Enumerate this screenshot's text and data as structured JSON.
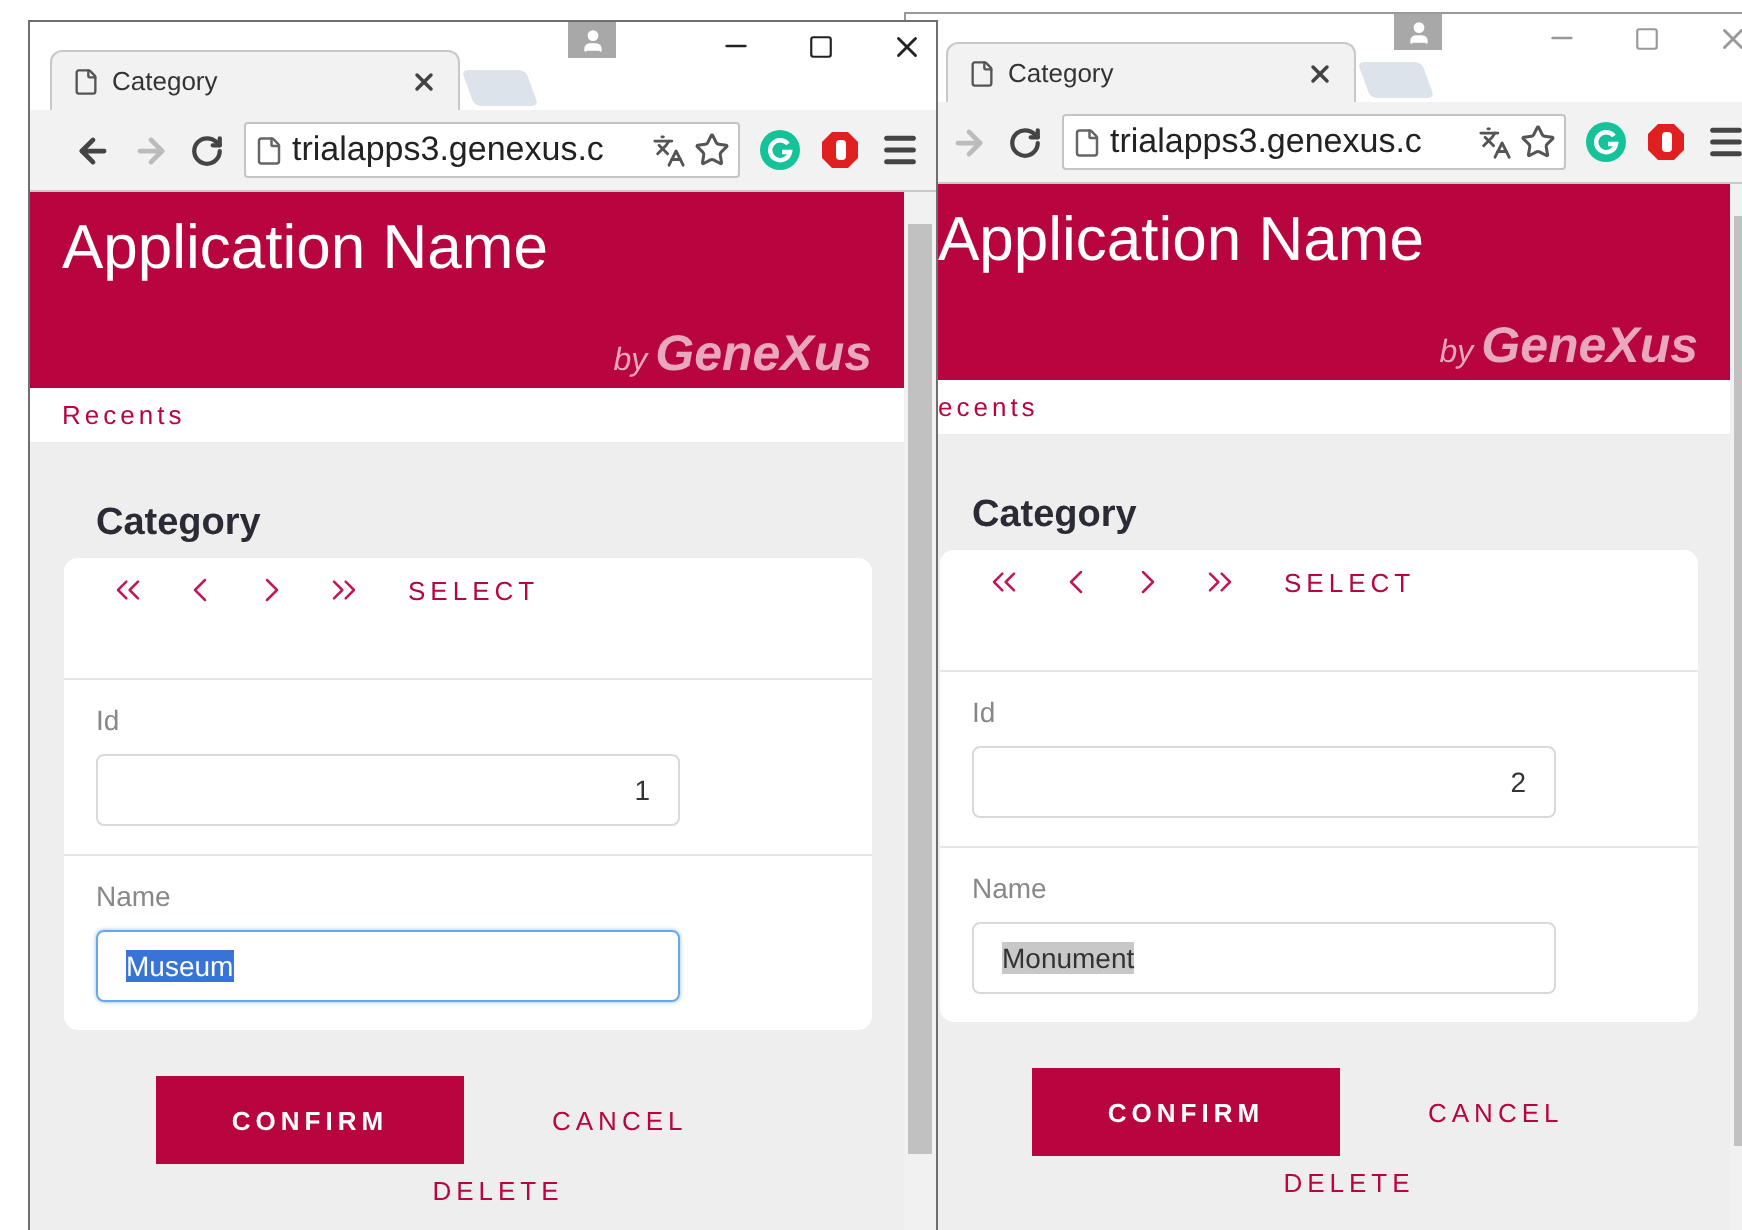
{
  "windows": [
    {
      "active": true,
      "tab_title": "Category",
      "url": "trialapps3.genexus.c",
      "app_name": "Application Name",
      "brand_prefix": "by",
      "brand": "GeneXus",
      "recents": "Recents",
      "form_title": "Category",
      "select": "SELECT",
      "fields": [
        {
          "label": "Id",
          "value": "1",
          "kind": "number",
          "focused": false
        },
        {
          "label": "Name",
          "value": "Museum",
          "kind": "text",
          "focused": true
        }
      ],
      "buttons": [
        {
          "label": "CONFIRM",
          "kind": "primary"
        },
        {
          "label": "CANCEL",
          "kind": "text"
        },
        {
          "label": "DELETE",
          "kind": "text"
        }
      ]
    },
    {
      "active": false,
      "tab_title": "Category",
      "url": "trialapps3.genexus.c",
      "app_name": "Application Name",
      "brand_prefix": "by",
      "brand": "GeneXus",
      "recents": "ecents",
      "form_title": "Category",
      "select": "SELECT",
      "fields": [
        {
          "label": "Id",
          "value": "2",
          "kind": "number",
          "focused": false
        },
        {
          "label": "Name",
          "value": "Monument",
          "kind": "text",
          "focused": false
        }
      ],
      "buttons": [
        {
          "label": "CONFIRM",
          "kind": "primary"
        },
        {
          "label": "CANCEL",
          "kind": "text"
        },
        {
          "label": "DELETE",
          "kind": "text"
        }
      ]
    }
  ]
}
